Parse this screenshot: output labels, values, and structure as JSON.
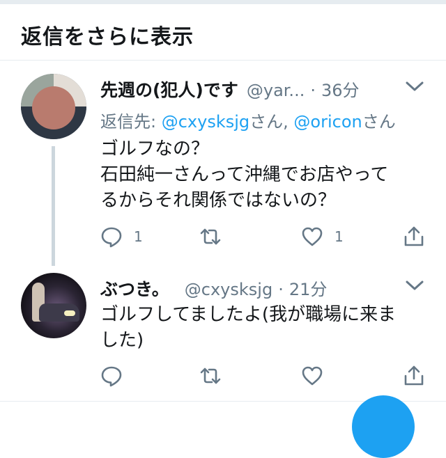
{
  "header": {
    "title": "返信をさらに表示"
  },
  "tweets": [
    {
      "name": "先週の(犯人)です",
      "handle": "@yar...",
      "time": "36分",
      "reply_prefix": "返信先: ",
      "reply_user1": "@cxysksjg",
      "reply_san1": "さん, ",
      "reply_user2": "@oricon",
      "reply_san2": "さん",
      "text": "ゴルフなの？\n石田純一さんって沖縄でお店やって\nるからそれ関係ではないの？",
      "reply_count": "1",
      "like_count": "1"
    },
    {
      "name": "ぶつき。",
      "handle": "@cxysksjg",
      "time": "21分",
      "text": "ゴルフしてましたよ(我が職場に来ま\nした)",
      "reply_count": "",
      "like_count": ""
    }
  ],
  "separator": "·",
  "colors": {
    "accent": "#1da1f2",
    "muted": "#657786",
    "border": "#e6ecf0"
  },
  "icons": [
    "reply-icon",
    "retweet-icon",
    "like-icon",
    "share-icon",
    "chevron-down-icon"
  ]
}
